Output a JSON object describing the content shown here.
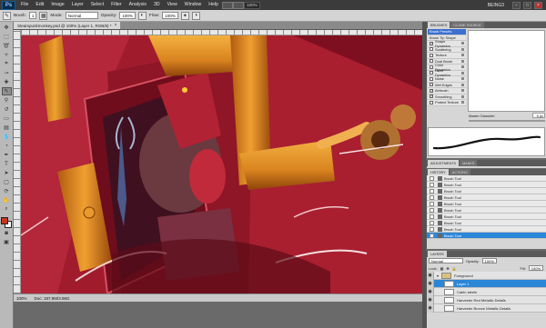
{
  "app": {
    "logo": "Ps",
    "menu": [
      "File",
      "Edit",
      "Image",
      "Layer",
      "Select",
      "Filter",
      "Analysis",
      "3D",
      "View",
      "Window",
      "Help"
    ],
    "zoom": "100%",
    "workspace": "BEING3"
  },
  "options": {
    "brush_label": "Brush:",
    "brush_size": "1",
    "mode_label": "Mode:",
    "mode_value": "Normal",
    "opacity_label": "Opacity:",
    "opacity_value": "100%",
    "flow_label": "Flow:",
    "flow_value": "100%"
  },
  "document": {
    "tab_title": "Steampunkmonkey.psd @ 100% (Layer 1, RGB/8) *",
    "status_zoom": "100%",
    "status_doc": "Doc: 187.9M/3.96G"
  },
  "brushes": {
    "tabs": [
      "BRUSHES",
      "CLONE SOURCE"
    ],
    "list": [
      {
        "label": "Brush Presets",
        "header": true
      },
      {
        "label": "Brush Tip Shape",
        "checked": null
      },
      {
        "label": "Shape Dynamics",
        "checked": true
      },
      {
        "label": "Scattering",
        "checked": false
      },
      {
        "label": "Texture",
        "checked": false
      },
      {
        "label": "Dual Brush",
        "checked": false
      },
      {
        "label": "Color Dynamics",
        "checked": false
      },
      {
        "label": "Other Dynamics",
        "checked": false
      },
      {
        "label": "Noise",
        "checked": false
      },
      {
        "label": "Wet Edges",
        "checked": false
      },
      {
        "label": "Airbrush",
        "checked": true
      },
      {
        "label": "Smoothing",
        "checked": true
      },
      {
        "label": "Protect Texture",
        "checked": false
      }
    ],
    "master_label": "Master Diameter",
    "master_value": "5 px"
  },
  "adjustments": {
    "tabs": [
      "ADJUSTMENTS",
      "MASKS"
    ]
  },
  "history": {
    "tabs": [
      "HISTORY",
      "ACTIONS"
    ],
    "items": [
      "Brush Tool",
      "Brush Tool",
      "Brush Tool",
      "Brush Tool",
      "Brush Tool",
      "Brush Tool",
      "Brush Tool",
      "Brush Tool",
      "Brush Tool",
      "Brush Tool"
    ]
  },
  "layers": {
    "tabs": [
      "LAYERS"
    ],
    "blend_mode": "Normal",
    "opacity_label": "Opacity:",
    "opacity_value": "100%",
    "lock_label": "Lock:",
    "fill_label": "Fill:",
    "fill_value": "100%",
    "items": [
      {
        "name": "Foreground",
        "folder": true,
        "active": false
      },
      {
        "name": "Layer 1",
        "folder": false,
        "active": true
      },
      {
        "name": "Cabin steels",
        "folder": false,
        "active": false
      },
      {
        "name": "Harvester Red Metallic Details",
        "folder": false,
        "active": false
      },
      {
        "name": "Harvester Bronze Metallic Details",
        "folder": false,
        "active": false
      }
    ]
  },
  "colors": {
    "foreground": "#c8331e",
    "background": "#ffffff",
    "canvas_red": "#a01c2c",
    "accent_blue": "#2c86d8"
  }
}
